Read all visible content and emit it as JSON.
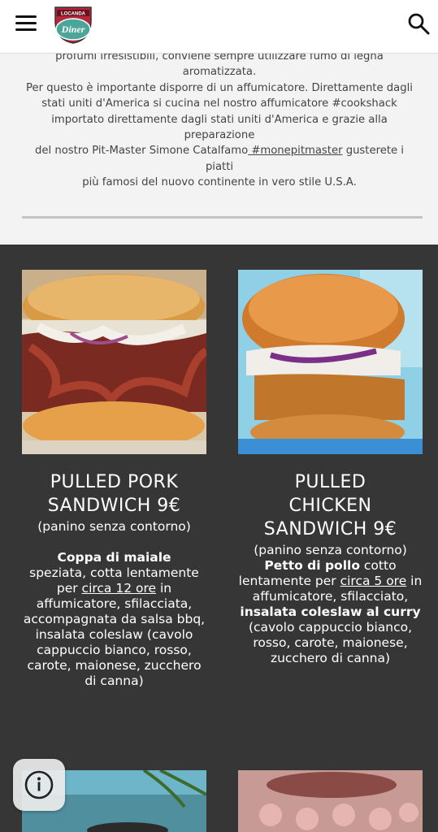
{
  "header": {
    "logo_text_top": "LOCANDA",
    "logo_text_main": "Diner",
    "icons": {
      "menu": "hamburger-menu-icon",
      "search": "search-icon"
    }
  },
  "intro": {
    "line1": "profumi irresistibili, conviene sempre utilizzare fumo di legna aromatizzata.",
    "line2": "Per questo è importante disporre di un affumicatore. Direttamente dagli",
    "line3": "stati uniti d'America si cucina nel nostro affumicatore #cookshack",
    "line4": "importato direttamente dagli stati uniti d'America e grazie alla preparazione",
    "line5_a": "del nostro Pit-Master Simone Catalfamo",
    "line5_tag": " #monepitmaster",
    "line5_b": " gusterete i piatti",
    "line6": "più famosi del nuovo continente in vero stile U.S.A."
  },
  "cards": [
    {
      "title_line1": "PULLED PORK",
      "title_line2": "SANDWICH 9€",
      "subtitle": "(panino senza contorno)",
      "desc_bold": "Coppa di maiale",
      "desc_a": "speziata, cotta lentamente per ",
      "desc_u": "circa 12 ore",
      "desc_b": " in affumicatore, sfilacciata, accompagnata da salsa bbq, insalata coleslaw (cavolo cappuccio bianco, rosso, carote, maionese, zucchero di canna)"
    },
    {
      "title_line1": "PULLED",
      "title_line2": "CHICKEN",
      "title_line3": "SANDWICH 9€",
      "subtitle": "(panino senza contorno)",
      "desc_bold": "Petto di pollo",
      "desc_a": " cotto lentamente per ",
      "desc_u": "circa 5 ore",
      "desc_b": " in affumicatore, sfilacciato, ",
      "desc_bold2": "insalata coleslaw al curry",
      "desc_c": " (cavolo cappuccio bianco, rosso, carote, maionese, zucchero di canna)"
    }
  ],
  "colors": {
    "dark_bg": "#363636",
    "light_bg": "#f3f3f3",
    "divider": "#c4c4c4"
  }
}
